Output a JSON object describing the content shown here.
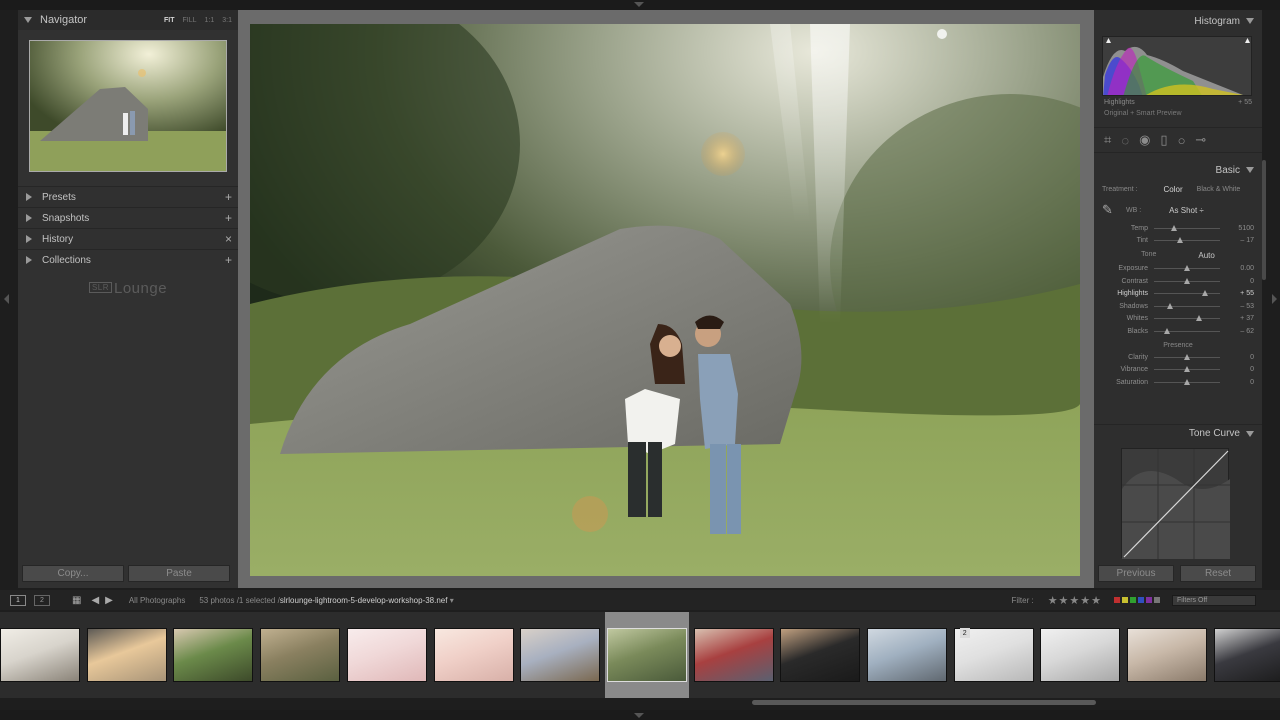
{
  "navigator": {
    "title": "Navigator",
    "zoom_options": [
      "FIT",
      "FILL",
      "1:1",
      "3:1"
    ],
    "zoom_active": "FIT"
  },
  "left_sections": [
    {
      "label": "Presets",
      "action": "+"
    },
    {
      "label": "Snapshots",
      "action": "+"
    },
    {
      "label": "History",
      "action": "×"
    },
    {
      "label": "Collections",
      "action": "+"
    }
  ],
  "logo": {
    "box": "SLR",
    "text": "Lounge"
  },
  "left_buttons": {
    "copy": "Copy...",
    "paste": "Paste"
  },
  "histogram": {
    "title": "Histogram",
    "info_label": "Highlights",
    "info_value": "+ 55",
    "original_preview": "Original + Smart Preview"
  },
  "tools": [
    "grid-crop",
    "spot-removal",
    "red-eye",
    "graduated-filter",
    "radial-filter",
    "adjustment-brush"
  ],
  "basic": {
    "title": "Basic",
    "treatment_label": "Treatment :",
    "treatment_color": "Color",
    "treatment_bw": "Black & White",
    "wb_label": "WB :",
    "wb_value": "As Shot ÷",
    "wb_sliders": [
      {
        "label": "Temp",
        "value": "5100",
        "position": 0.3
      },
      {
        "label": "Tint",
        "value": "– 17",
        "position": 0.4
      }
    ],
    "tone_label": "Tone",
    "auto_label": "Auto",
    "tone_sliders": [
      {
        "label": "Exposure",
        "value": "0.00",
        "position": 0.5
      },
      {
        "label": "Contrast",
        "value": "0",
        "position": 0.5
      },
      {
        "label": "Highlights",
        "value": "+ 55",
        "position": 0.77
      },
      {
        "label": "Shadows",
        "value": "– 53",
        "position": 0.24
      },
      {
        "label": "Whites",
        "value": "+ 37",
        "position": 0.68
      },
      {
        "label": "Blacks",
        "value": "– 62",
        "position": 0.19
      }
    ],
    "presence_label": "Presence",
    "presence_sliders": [
      {
        "label": "Clarity",
        "value": "0",
        "position": 0.5
      },
      {
        "label": "Vibrance",
        "value": "0",
        "position": 0.5
      },
      {
        "label": "Saturation",
        "value": "0",
        "position": 0.5
      }
    ]
  },
  "tone_curve": {
    "title": "Tone Curve"
  },
  "right_buttons": {
    "previous": "Previous",
    "reset": "Reset"
  },
  "filmbar": {
    "screen1": "1",
    "screen2": "2",
    "source": "All Photographs",
    "count": "53 photos /1 selected /",
    "filename": "slrlounge-lightroom-5-develop-workshop-38.nef",
    "filter_label": "Filter :",
    "stars": "★★★★★",
    "filter_value": "Filters Off"
  },
  "filmstrip": {
    "selected_index": 7,
    "stack_badge": "2",
    "thumbs": [
      {
        "name": "bride-embrace",
        "colors": [
          "#d8d4cc",
          "#8a8378",
          "#f0ede6"
        ]
      },
      {
        "name": "beach-sunset",
        "colors": [
          "#e8c89a",
          "#a89478",
          "#5d5a55"
        ]
      },
      {
        "name": "couple-park",
        "colors": [
          "#6b8a4a",
          "#3d4a2a",
          "#d8c8b0"
        ]
      },
      {
        "name": "couple-field-kiss",
        "colors": [
          "#8a8060",
          "#5a6040",
          "#c0b090"
        ]
      },
      {
        "name": "newborn-pink-hat",
        "colors": [
          "#f0d8d8",
          "#e0b8b8",
          "#f8ecec"
        ]
      },
      {
        "name": "newborn-sleeping",
        "colors": [
          "#f0d0c8",
          "#d8b0a8",
          "#f8e8e0"
        ]
      },
      {
        "name": "newborn-basket",
        "colors": [
          "#a8b0c0",
          "#7a6850",
          "#d8d0c8"
        ]
      },
      {
        "name": "couple-kiss-rock",
        "colors": [
          "#7a8a5a",
          "#4a5a3a",
          "#c0c8a0"
        ]
      },
      {
        "name": "family-red-car",
        "colors": [
          "#a84040",
          "#5a6070",
          "#d8c0b0"
        ]
      },
      {
        "name": "man-portrait",
        "colors": [
          "#2a2a2a",
          "#1a1a1a",
          "#c0a080"
        ]
      },
      {
        "name": "motorcycle-road",
        "colors": [
          "#a0b0c0",
          "#606870",
          "#d0d8e0"
        ]
      },
      {
        "name": "wedding-dress",
        "colors": [
          "#e0e0e0",
          "#b8b8b8",
          "#f0f0f0"
        ]
      },
      {
        "name": "wedding-dress-2",
        "colors": [
          "#d8d8d8",
          "#a8a8a8",
          "#f0f0f0"
        ]
      },
      {
        "name": "wedding-couple",
        "colors": [
          "#c8b8a8",
          "#8a7a6a",
          "#e8e0d8"
        ]
      },
      {
        "name": "groom-suit",
        "colors": [
          "#3a3a40",
          "#1a1a1a",
          "#d0d0d0"
        ]
      }
    ]
  }
}
